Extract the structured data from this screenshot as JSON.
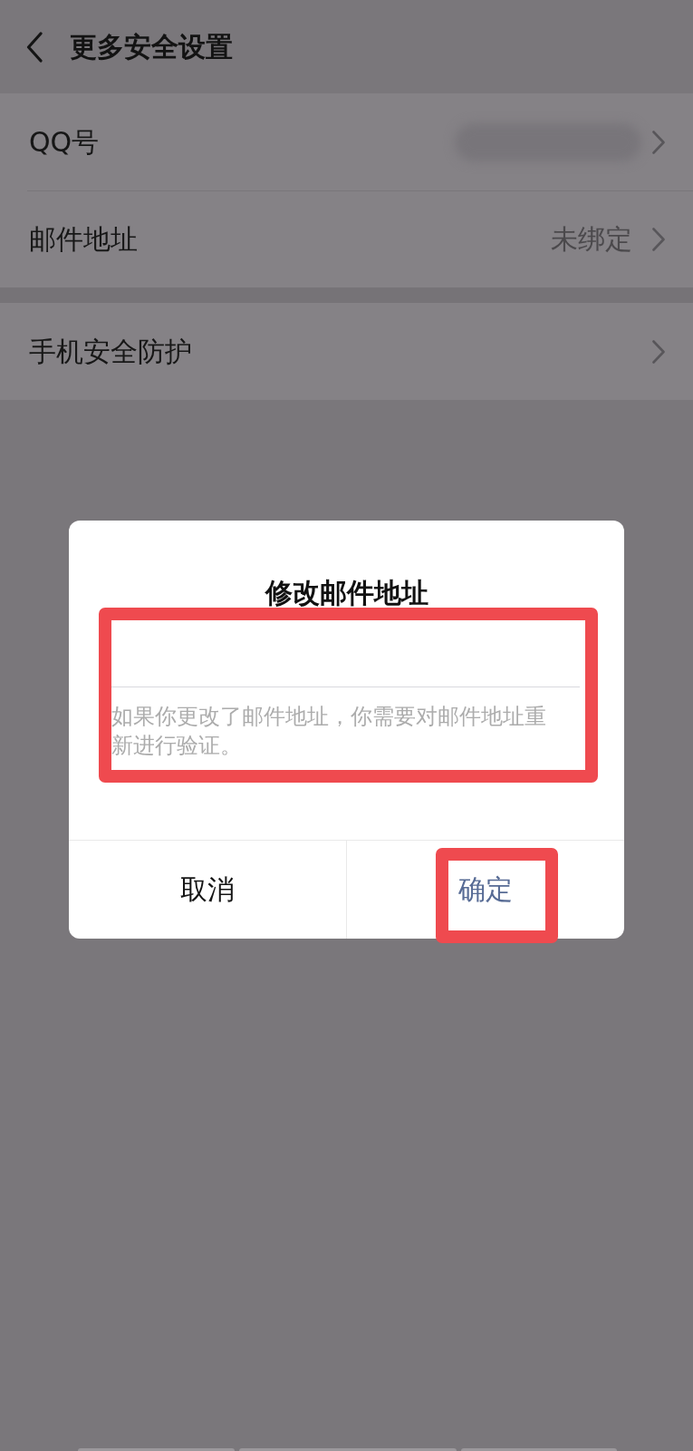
{
  "header": {
    "title": "更多安全设置"
  },
  "groups": [
    {
      "rows": [
        {
          "label": "QQ号",
          "kind": "redacted"
        },
        {
          "label": "邮件地址",
          "kind": "value",
          "value": "未绑定"
        }
      ]
    },
    {
      "rows": [
        {
          "label": "手机安全防护",
          "kind": "plain"
        }
      ]
    }
  ],
  "dialog": {
    "title": "修改邮件地址",
    "hint": "如果你更改了邮件地址，你需要对邮件地址重新进行验证。",
    "input_highlighted": true,
    "buttons": [
      {
        "label": "取消",
        "kind": "cancel",
        "highlighted": false
      },
      {
        "label": "确定",
        "kind": "confirm",
        "highlighted": true
      }
    ]
  }
}
